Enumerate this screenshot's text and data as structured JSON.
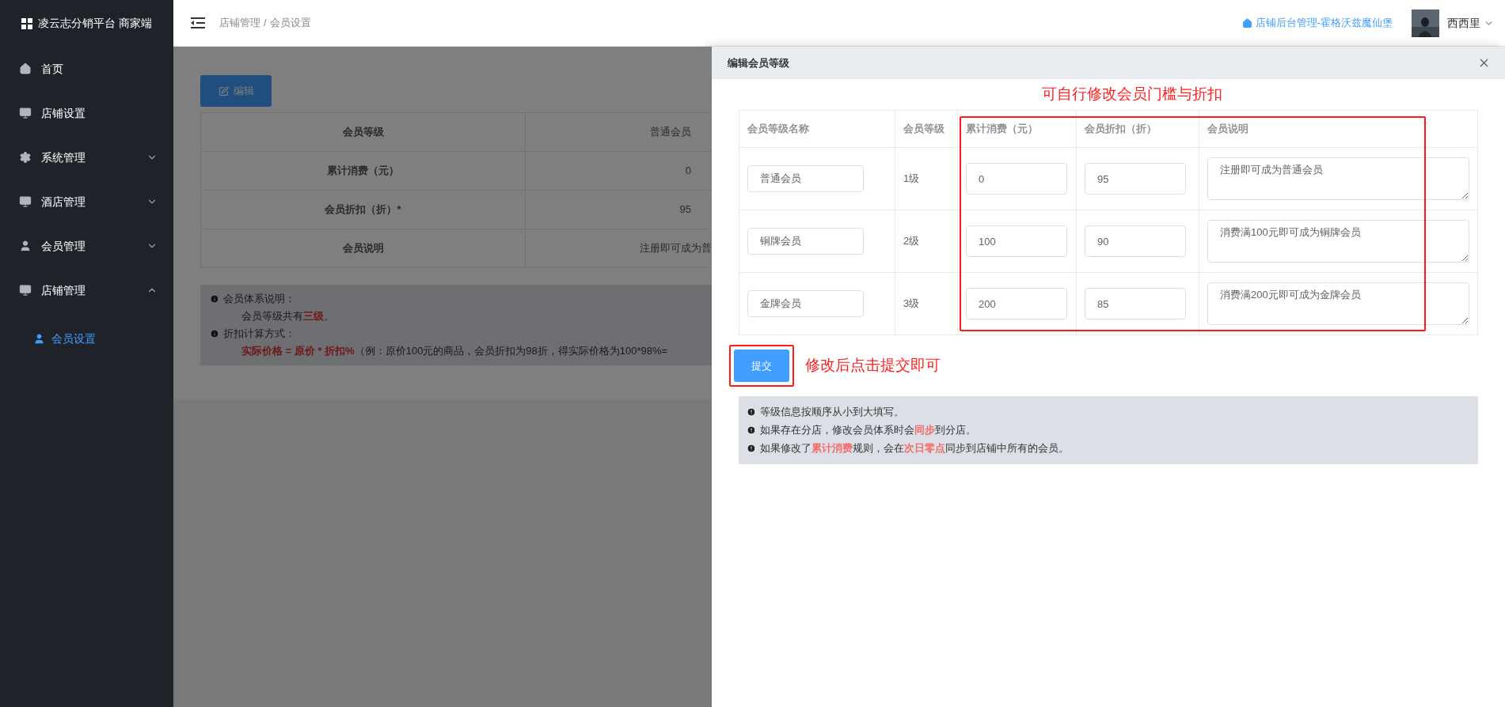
{
  "sidebar": {
    "brand": "凌云志分销平台 商家端",
    "items": [
      {
        "label": "首页",
        "kind": "link",
        "selected": false
      },
      {
        "label": "店铺设置",
        "kind": "link",
        "selected": false
      },
      {
        "label": "系统管理",
        "kind": "group",
        "expanded": false,
        "selected": false
      },
      {
        "label": "酒店管理",
        "kind": "group",
        "expanded": false,
        "selected": false
      },
      {
        "label": "会员管理",
        "kind": "group",
        "expanded": false,
        "selected": false
      },
      {
        "label": "店铺管理",
        "kind": "group",
        "expanded": true,
        "selected": false,
        "children": [
          {
            "label": "会员设置",
            "selected": true
          }
        ]
      }
    ]
  },
  "header": {
    "breadcrumb": [
      "店铺管理",
      "会员设置"
    ],
    "separator": "/",
    "store_link": "店铺后台管理-霍格沃兹魔仙堡",
    "user": "西西里"
  },
  "page": {
    "edit_button": "编辑",
    "detail_table": [
      {
        "label": "会员等级",
        "value": "普通会员"
      },
      {
        "label": "累计消费（元）",
        "value": "0"
      },
      {
        "label": "会员折扣（折）*",
        "value": "95"
      },
      {
        "label": "会员说明",
        "value": "注册即可成为普"
      }
    ],
    "notes": [
      {
        "kind": "heading",
        "text": "会员体系说明："
      },
      {
        "kind": "detail",
        "text": "会员等级共有**三级**。"
      },
      {
        "kind": "heading",
        "text": "折扣计算方式："
      },
      {
        "kind": "detail",
        "text": "**实际价格 = 原价 * 折扣%**（例：原价100元的商品，会员折扣为98折，得实际价格为100*98%="
      }
    ]
  },
  "drawer": {
    "title": "编辑会员等级",
    "annotation_table": "可自行修改会员门槛与折扣",
    "columns": [
      "会员等级名称",
      "会员等级",
      "累计消费（元）",
      "会员折扣（折）",
      "会员说明"
    ],
    "rows": [
      {
        "name": "普通会员",
        "level": "1级",
        "spend": "0",
        "discount": "95",
        "description": "注册即可成为普通会员"
      },
      {
        "name": "铜牌会员",
        "level": "2级",
        "spend": "100",
        "discount": "90",
        "description": "消费满100元即可成为铜牌会员"
      },
      {
        "name": "金牌会员",
        "level": "3级",
        "spend": "200",
        "discount": "85",
        "description": "消费满200元即可成为金牌会员"
      }
    ],
    "submit_button": "提交",
    "annotation_submit": "修改后点击提交即可",
    "notes": [
      "等级信息按顺序从小到大填写。",
      "如果存在分店，修改会员体系时会**同步**到分店。",
      "如果修改了**累计消费**规则，会在**次日零点**同步到店铺中所有的会员。"
    ]
  }
}
